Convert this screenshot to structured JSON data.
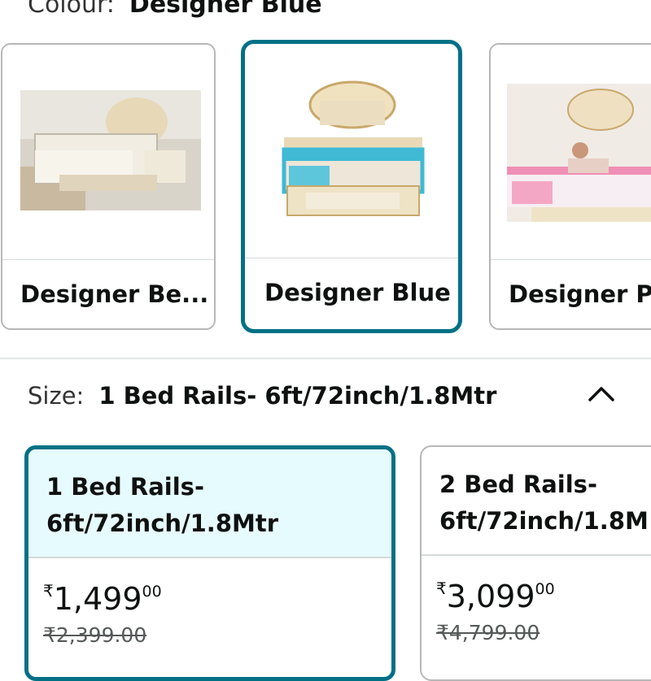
{
  "colour": {
    "label": "Colour:",
    "value": "Designer Blue"
  },
  "swatches": [
    {
      "name": "Designer Be...",
      "selected": false,
      "rail_color": "#ece9d8"
    },
    {
      "name": "Designer Blue",
      "selected": true,
      "rail_color": "#3fb9d4"
    },
    {
      "name": "Designer Pi",
      "selected": false,
      "rail_color": "#ef8fb5"
    }
  ],
  "size": {
    "label": "Size:",
    "value": "1 Bed Rails- 6ft/72inch/1.8Mtr",
    "collapse_icon": "chevron-up-icon"
  },
  "size_options": [
    {
      "line1": "1 Bed Rails-",
      "line2": "6ft/72inch/1.8Mtr",
      "currency": "₹",
      "price_whole": "1,499",
      "price_fraction": "00",
      "mrp": "₹2,399.00",
      "selected": true
    },
    {
      "line1": "2 Bed Rails-",
      "line2": "6ft/72inch/1.8M",
      "currency": "₹",
      "price_whole": "3,099",
      "price_fraction": "00",
      "mrp": "₹4,799.00",
      "selected": false
    }
  ],
  "colors": {
    "accent": "#007185",
    "selected_bg": "#e6fbfd",
    "border": "#b7b7b7"
  }
}
